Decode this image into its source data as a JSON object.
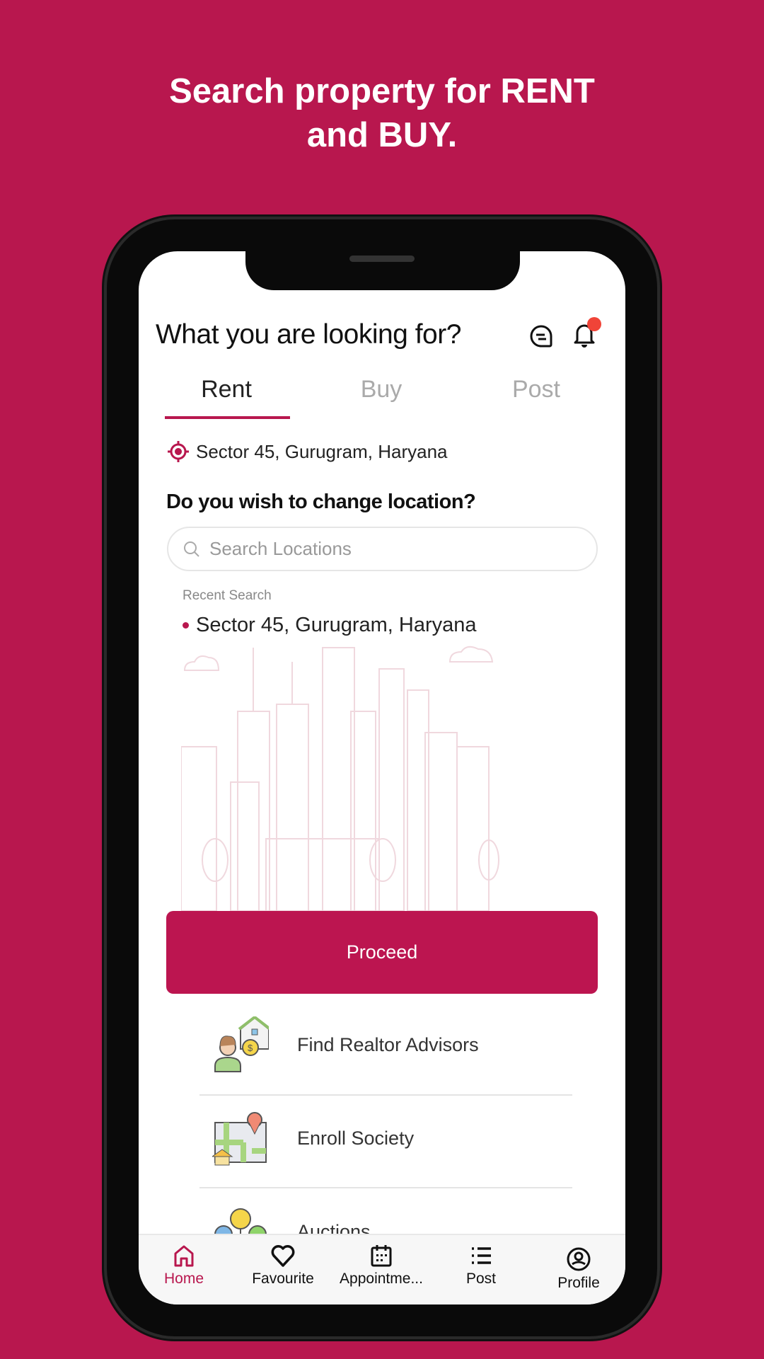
{
  "headline": {
    "line1": "Search property for RENT",
    "line2": "and BUY."
  },
  "header": {
    "title": "What you are looking for?",
    "chat_icon": "chat-icon",
    "bell_icon": "bell-icon",
    "notification_dot_color": "#F04438"
  },
  "tabs": [
    {
      "label": "Rent",
      "active": true
    },
    {
      "label": "Buy",
      "active": false
    },
    {
      "label": "Post",
      "active": false
    }
  ],
  "current_location": "Sector 45, Gurugram, Haryana",
  "change_location": {
    "question": "Do you wish to change location?",
    "search_placeholder": "Search Locations"
  },
  "recent": {
    "label": "Recent Search",
    "items": [
      "Sector 45, Gurugram, Haryana"
    ]
  },
  "proceed_label": "Proceed",
  "services": [
    {
      "label": "Find Realtor Advisors",
      "icon": "realtor-advisor-icon"
    },
    {
      "label": "Enroll Society",
      "icon": "society-map-icon"
    },
    {
      "label": "Auctions",
      "icon": "auction-balloons-icon"
    }
  ],
  "bottom_nav": [
    {
      "label": "Home",
      "icon": "home-icon",
      "active": true
    },
    {
      "label": "Favourite",
      "icon": "heart-icon"
    },
    {
      "label": "Appointme...",
      "icon": "calendar-icon"
    },
    {
      "label": "Post",
      "icon": "list-icon"
    },
    {
      "label": "Profile",
      "icon": "profile-icon"
    }
  ],
  "colors": {
    "brand": "#B8174E",
    "button": "#BC1550"
  }
}
